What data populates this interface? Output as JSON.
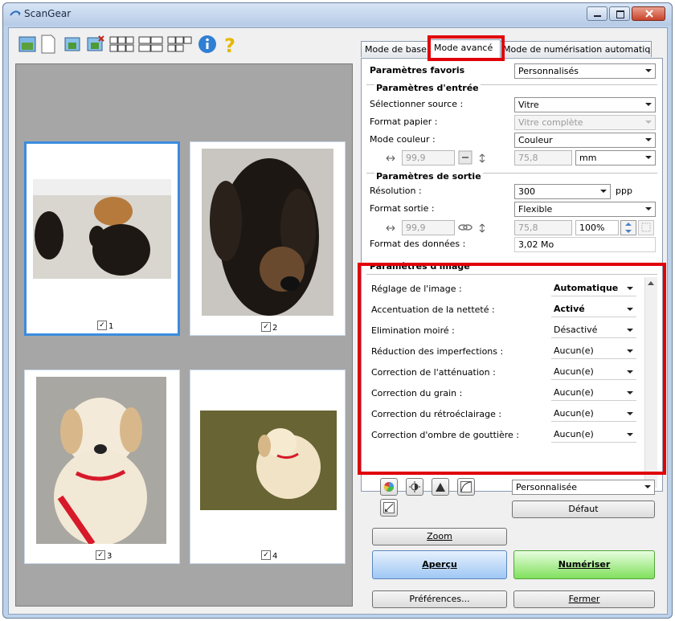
{
  "window": {
    "title": "ScanGear"
  },
  "tabs": [
    {
      "label": "Mode de base"
    },
    {
      "label": "Mode avancé"
    },
    {
      "label": "Mode de numérisation automatique"
    }
  ],
  "thumbnails": [
    {
      "number": "1",
      "checked": "✓"
    },
    {
      "number": "2",
      "checked": "✓"
    },
    {
      "number": "3",
      "checked": "✓"
    },
    {
      "number": "4",
      "checked": "✓"
    }
  ],
  "favorites": {
    "label": "Paramètres favoris",
    "value": "Personnalisés"
  },
  "input": {
    "heading": "Paramètres d'entrée",
    "source_label": "Sélectionner source :",
    "source_value": "Vitre",
    "paper_label": "Format papier :",
    "paper_value": "Vitre complète",
    "color_label": "Mode couleur :",
    "color_value": "Couleur",
    "width": "99,9",
    "height": "75,8",
    "unit": "mm"
  },
  "output": {
    "heading": "Paramètres de sortie",
    "resolution_label": "Résolution :",
    "resolution_value": "300",
    "resolution_unit": "ppp",
    "format_label": "Format sortie :",
    "format_value": "Flexible",
    "width": "99,9",
    "height": "75,8",
    "scale": "100%",
    "data_label": "Format des données :",
    "data_value": "3,02 Mo"
  },
  "image_settings": {
    "heading": "Paramètres d'image",
    "rows": [
      {
        "label": "Réglage de l'image :",
        "value": "Automatique"
      },
      {
        "label": "Accentuation de la netteté :",
        "value": "Activé"
      },
      {
        "label": "Elimination moiré :",
        "value": "Désactivé"
      },
      {
        "label": "Réduction des imperfections :",
        "value": "Aucun(e)"
      },
      {
        "label": "Correction de l'atténuation :",
        "value": "Aucun(e)"
      },
      {
        "label": "Correction du grain :",
        "value": "Aucun(e)"
      },
      {
        "label": "Correction du rétroéclairage :",
        "value": "Aucun(e)"
      },
      {
        "label": "Correction d'ombre de gouttière :",
        "value": "Aucun(e)"
      }
    ]
  },
  "adjust": {
    "preset_value": "Personnalisée",
    "default_label": "Défaut"
  },
  "buttons": {
    "zoom": "Zoom",
    "preview": "Aperçu",
    "scan": "Numériser",
    "preferences": "Préférences...",
    "close": "Fermer"
  },
  "colors": {
    "highlight": "#e0000a",
    "selection": "#3b8cde",
    "scan_button": "#7fe05c",
    "preview_button": "#9ec7f4"
  }
}
